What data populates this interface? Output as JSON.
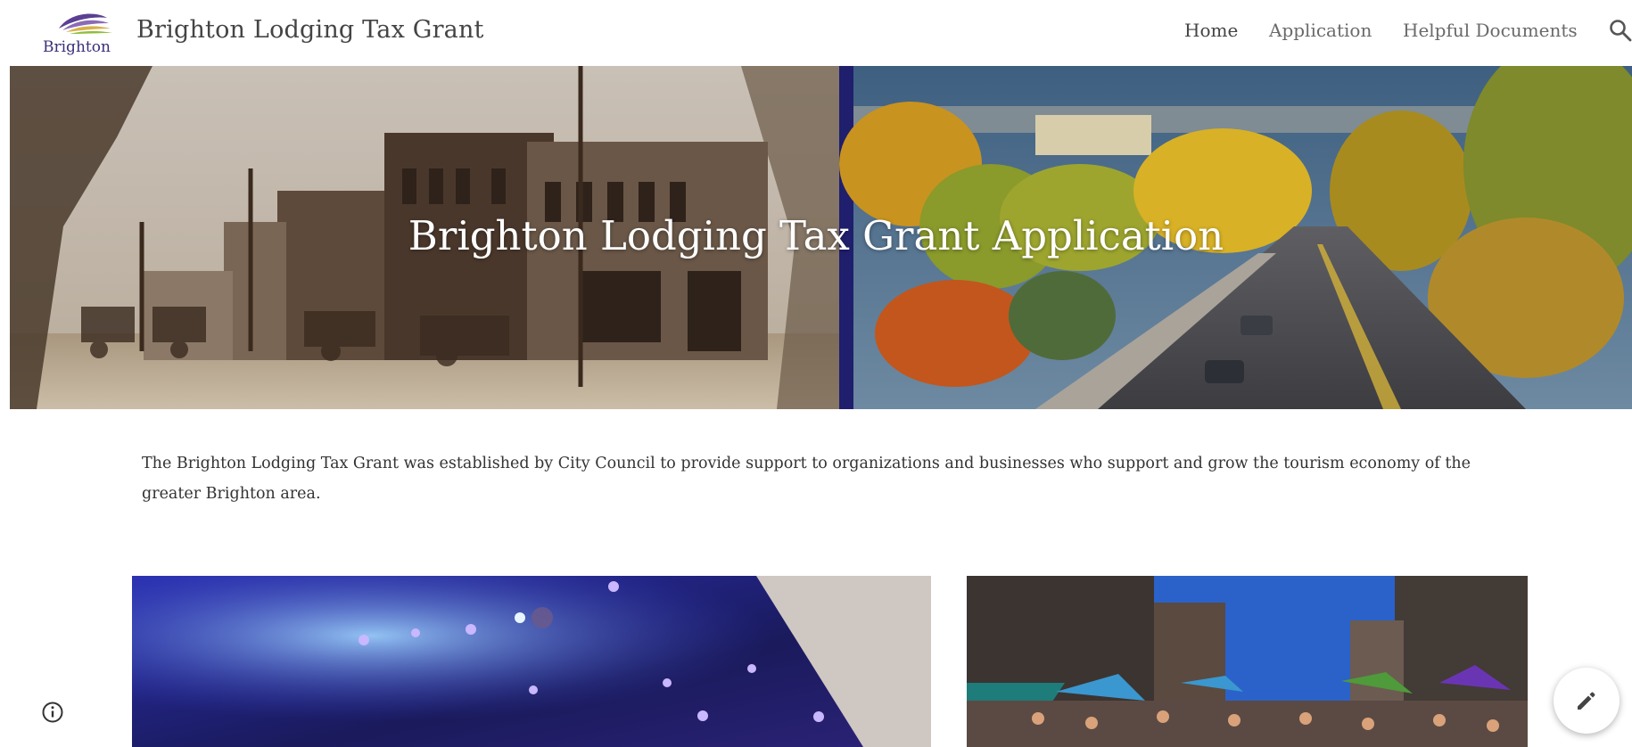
{
  "header": {
    "logo_text": "Brighton",
    "site_title": "Brighton Lodging Tax Grant",
    "nav": [
      "Home",
      "Application",
      "Helpful Documents"
    ],
    "active_nav": "Home",
    "search_icon": "search-icon"
  },
  "hero": {
    "title": "Brighton Lodging Tax Grant Application"
  },
  "main": {
    "intro": "The Brighton Lodging Tax Grant was established by City Council to provide support to organizations and businesses who support and grow the tourism economy of the greater Brighton area."
  },
  "footer": {
    "info_icon": "info-icon",
    "edit_icon": "pencil-icon"
  },
  "colors": {
    "brand_purple": "#3b2f7a",
    "logo_green": "#8fbf3c",
    "logo_gold": "#d8b14a",
    "divider_navy": "#1f1f6e"
  }
}
